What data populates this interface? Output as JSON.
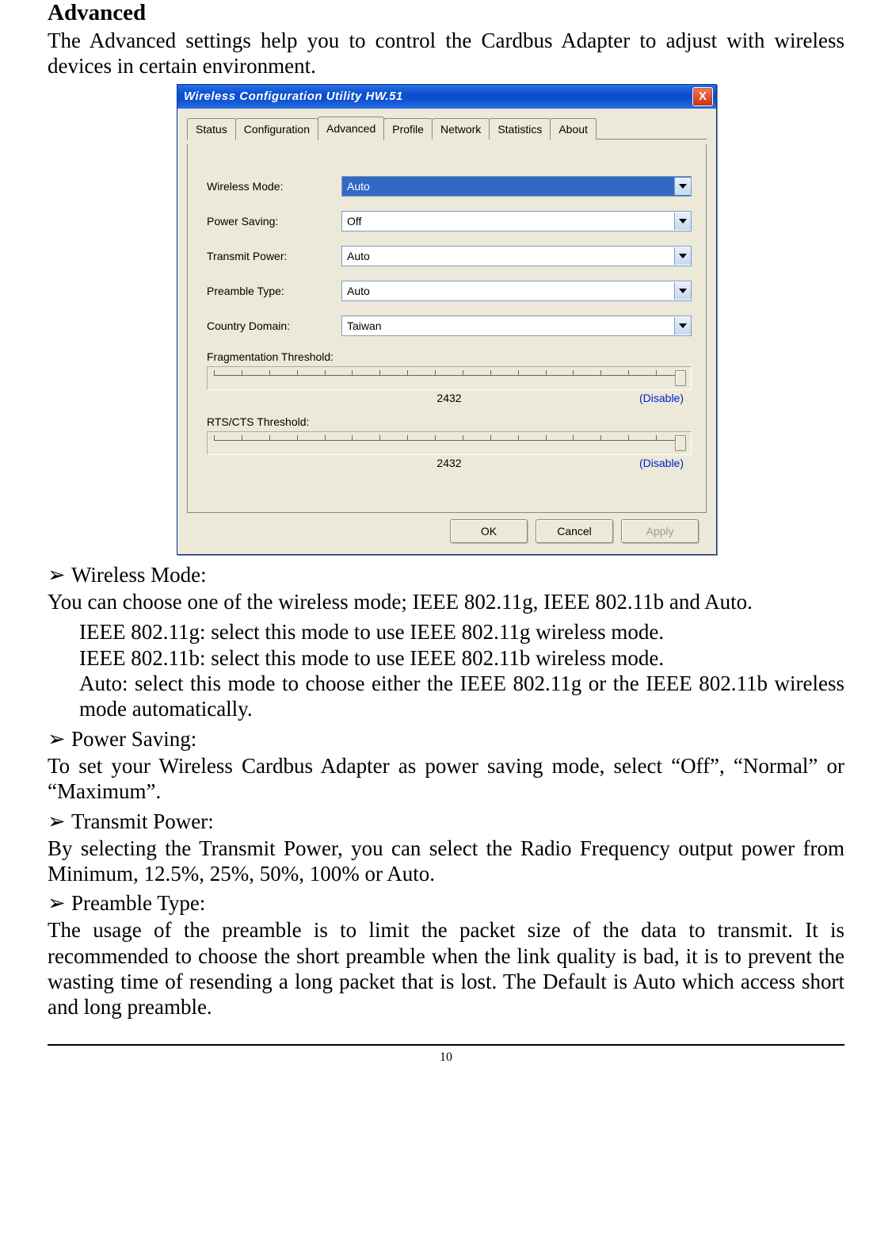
{
  "doc": {
    "heading": "Advanced",
    "intro": "The Advanced settings help you to control the Cardbus Adapter to adjust with wireless devices in certain environment.",
    "bullets": {
      "wm_title": "Wireless Mode:",
      "wm_body": "You can choose one of the wireless mode; IEEE 802.11g, IEEE 802.11b and Auto.",
      "wm_g": "IEEE 802.11g: select this mode to use IEEE 802.11g wireless mode.",
      "wm_b": "IEEE 802.11b: select this mode to use IEEE 802.11b wireless mode.",
      "wm_auto": "Auto: select this mode to choose either the IEEE 802.11g or the IEEE 802.11b wireless mode automatically.",
      "ps_title": "Power Saving:",
      "ps_body": "To set your Wireless Cardbus Adapter as power saving mode, select “Off”, “Normal” or “Maximum”.",
      "tp_title": "Transmit Power:",
      "tp_body": "By selecting the Transmit Power, you can select the Radio Frequency output power from Minimum, 12.5%, 25%, 50%, 100% or Auto.",
      "pt_title": "Preamble Type:",
      "pt_body": "The usage of the preamble is to limit the packet size of the data to transmit. It is recommended to choose the short preamble when the link quality is bad, it is to prevent the wasting time of resending a long packet that is lost. The Default is Auto which access short and long preamble."
    },
    "arrow": "➢",
    "page_number": "10"
  },
  "dialog": {
    "title": "Wireless Configuration Utility HW.51",
    "close": "X",
    "tabs": [
      "Status",
      "Configuration",
      "Advanced",
      "Profile",
      "Network",
      "Statistics",
      "About"
    ],
    "active_tab": 2,
    "fields": {
      "wireless_mode": {
        "label": "Wireless Mode:",
        "value": "Auto"
      },
      "power_saving": {
        "label": "Power Saving:",
        "value": "Off"
      },
      "transmit_power": {
        "label": "Transmit Power:",
        "value": "Auto"
      },
      "preamble_type": {
        "label": "Preamble Type:",
        "value": "Auto"
      },
      "country_domain": {
        "label": "Country Domain:",
        "value": "Taiwan"
      }
    },
    "frag": {
      "label": "Fragmentation Threshold:",
      "value": "2432",
      "status": "(Disable)"
    },
    "rts": {
      "label": "RTS/CTS Threshold:",
      "value": "2432",
      "status": "(Disable)"
    },
    "buttons": {
      "ok": "OK",
      "cancel": "Cancel",
      "apply": "Apply"
    }
  }
}
